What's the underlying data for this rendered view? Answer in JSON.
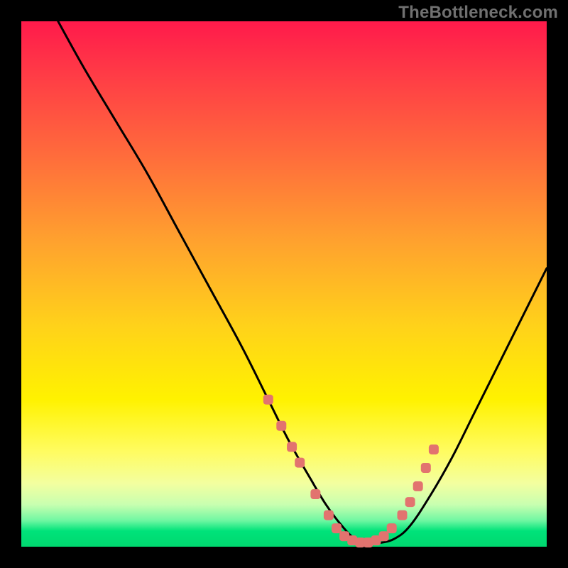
{
  "watermark": "TheBottleneck.com",
  "chart_data": {
    "type": "line",
    "title": "",
    "xlabel": "",
    "ylabel": "",
    "xlim": [
      0,
      100
    ],
    "ylim": [
      0,
      100
    ],
    "grid": false,
    "legend": false,
    "series": [
      {
        "name": "bottleneck-curve",
        "x": [
          7,
          12,
          18,
          24,
          30,
          36,
          42,
          47,
          51,
          55,
          58,
          61,
          63.5,
          66,
          68,
          71,
          74,
          78,
          82,
          86,
          90,
          94,
          98,
          100
        ],
        "y": [
          100,
          91,
          81,
          71,
          60,
          49,
          38,
          28,
          20,
          13,
          8,
          4,
          1.5,
          0.7,
          0.7,
          1.5,
          4,
          10,
          17,
          25,
          33,
          41,
          49,
          53
        ]
      }
    ],
    "markers": {
      "name": "highlight-dots",
      "color": "#e2736f",
      "x": [
        47,
        49.5,
        51.5,
        53,
        56,
        58.5,
        60,
        61.5,
        63,
        64.5,
        66,
        67.5,
        69,
        70.5,
        72.5,
        74,
        75.5,
        77,
        78.5
      ],
      "y": [
        28,
        23,
        19,
        16,
        10,
        6,
        3.5,
        2,
        1.2,
        0.8,
        0.8,
        1.2,
        2,
        3.5,
        6,
        8.5,
        11.5,
        15,
        18.5
      ]
    },
    "background_gradient": {
      "top": "#ff1a4b",
      "mid": "#fff200",
      "bottom": "#00d86f"
    }
  }
}
